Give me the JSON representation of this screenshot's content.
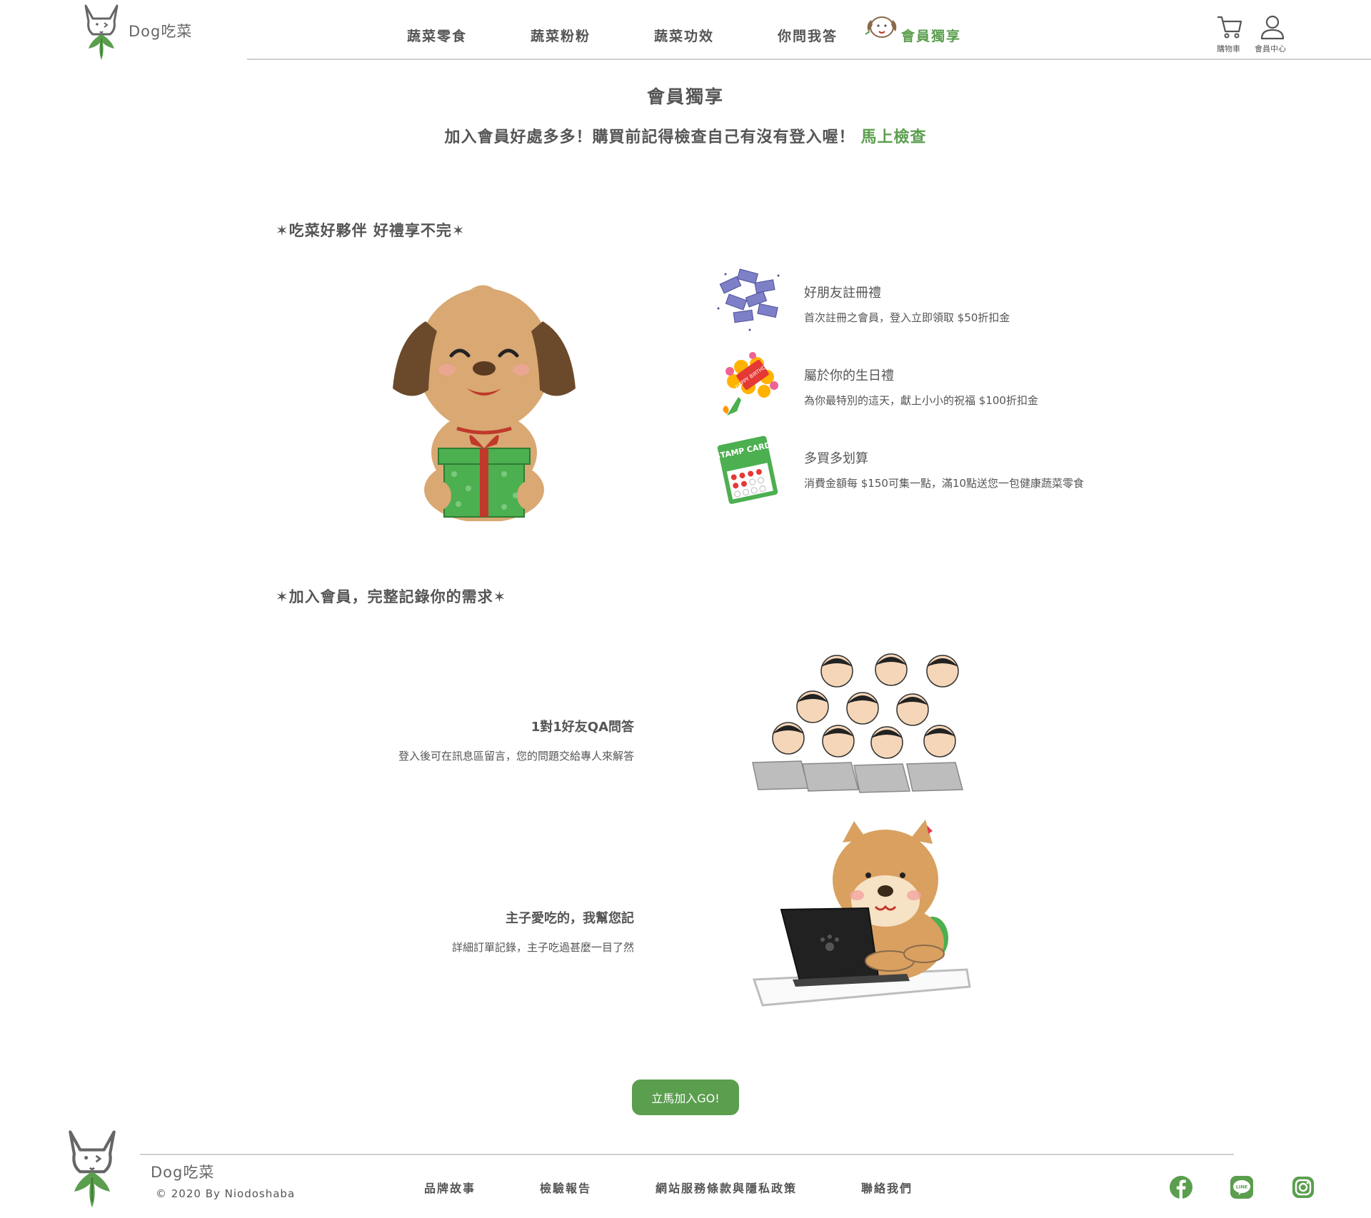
{
  "brand": {
    "name": "Dog吃菜"
  },
  "nav": {
    "items": [
      "蔬菜零食",
      "蔬菜粉粉",
      "蔬菜功效",
      "你問我答",
      "會員獨享"
    ],
    "cart_label": "購物車",
    "member_label": "會員中心"
  },
  "page": {
    "title": "會員獨享",
    "intro": "加入會員好處多多！購買前記得檢查自己有沒有登入喔！",
    "intro_link": "馬上檢查"
  },
  "benefits": {
    "heading": "✶吃菜好夥伴 好禮享不完✶",
    "items": [
      {
        "title": "好朋友註冊禮",
        "desc": "首次註冊之會員，登入立即領取 $50折扣金"
      },
      {
        "title": "屬於你的生日禮",
        "desc": "為你最特別的這天，獻上小小的祝福 $100折扣金"
      },
      {
        "title": "多買多划算",
        "desc": "消費金額每 $150可集一點，滿10點送您一包健康蔬菜零食"
      }
    ],
    "stamp_card_text": "STAMP CARD",
    "birthday_text": "HAPPY BIRTHDAY"
  },
  "needs": {
    "heading": "✶加入會員，完整記錄你的需求✶",
    "items": [
      {
        "title": "1對1好友QA問答",
        "desc": "登入後可在訊息區留言，您的問題交給專人來解答"
      },
      {
        "title": "主子愛吃的，我幫您記",
        "desc": "詳細訂單記錄，主子吃過甚麼一目了然"
      }
    ]
  },
  "cta": {
    "label": "立馬加入GO!"
  },
  "footer": {
    "brand": "Dog吃菜",
    "copyright": "© 2020 By Niodoshaba",
    "links": [
      "品牌故事",
      "檢驗報告",
      "網站服務條款與隱私政策",
      "聯絡我們"
    ],
    "social": [
      "facebook-icon",
      "line-icon",
      "instagram-icon"
    ]
  },
  "colors": {
    "accent": "#5a9e4e",
    "text": "#555555",
    "divider": "#cfcfcf"
  }
}
